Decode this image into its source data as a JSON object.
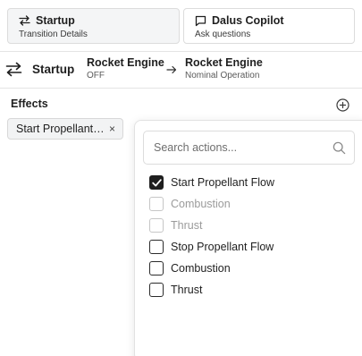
{
  "tabs": [
    {
      "title": "Startup",
      "subtitle": "Transition Details",
      "icon": "arrows-swap-icon",
      "active": true
    },
    {
      "title": "Dalus Copilot",
      "subtitle": "Ask questions",
      "icon": "chat-bubble-icon",
      "active": false
    }
  ],
  "transition": {
    "name": "Startup",
    "from": {
      "title": "Rocket Engine",
      "state": "OFF"
    },
    "to": {
      "title": "Rocket Engine",
      "state": "Nominal Operation"
    }
  },
  "effects": {
    "label": "Effects",
    "chips": [
      {
        "label": "Start Propellant Flow"
      }
    ]
  },
  "dropdown": {
    "search_placeholder": "Search actions...",
    "options": [
      {
        "label": "Start Propellant Flow",
        "checked": true,
        "disabled": false
      },
      {
        "label": "Combustion",
        "checked": false,
        "disabled": true
      },
      {
        "label": "Thrust",
        "checked": false,
        "disabled": true
      },
      {
        "label": "Stop Propellant Flow",
        "checked": false,
        "disabled": false
      },
      {
        "label": "Combustion",
        "checked": false,
        "disabled": false
      },
      {
        "label": "Thrust",
        "checked": false,
        "disabled": false
      }
    ]
  },
  "colors": {
    "text": "#1f1f1f",
    "muted": "#9b9b9b",
    "border": "#dcdcdc",
    "active_tab_bg": "#f4f5f6"
  }
}
